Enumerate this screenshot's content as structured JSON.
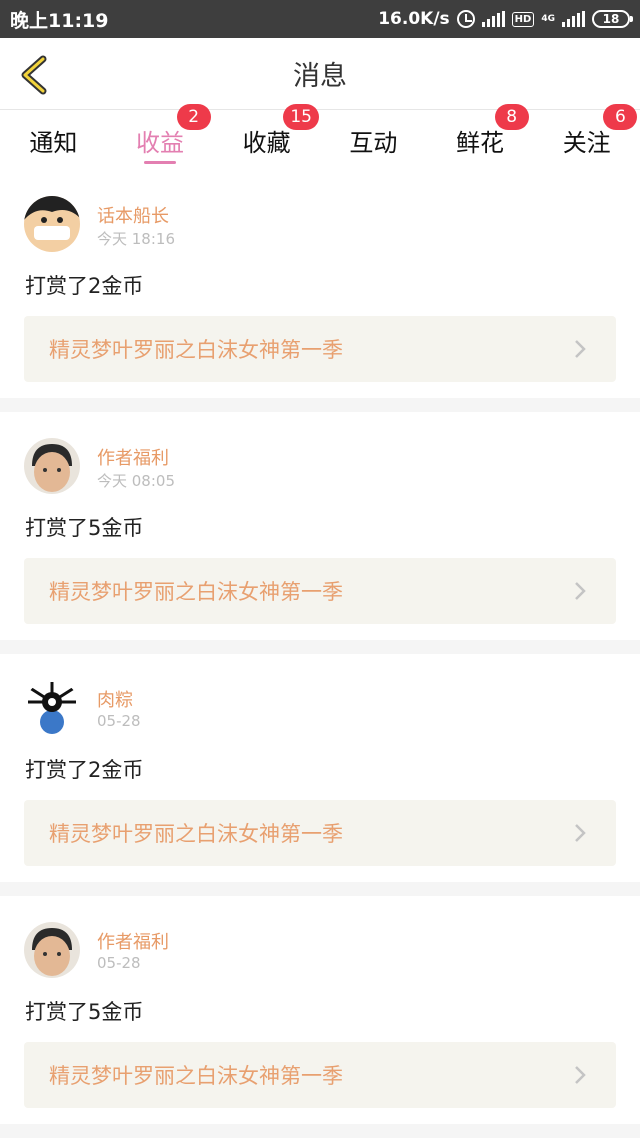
{
  "status_bar": {
    "time": "晚上11:19",
    "speed": "16.0K/s",
    "hd": "HD",
    "net": "4G",
    "battery": "18"
  },
  "header": {
    "title": "消息"
  },
  "tabs": [
    {
      "label": "通知",
      "badge": ""
    },
    {
      "label": "收益",
      "badge": "2",
      "active": true
    },
    {
      "label": "收藏",
      "badge": "15"
    },
    {
      "label": "互动",
      "badge": ""
    },
    {
      "label": "鲜花",
      "badge": "8"
    },
    {
      "label": "关注",
      "badge": "6"
    }
  ],
  "messages": [
    {
      "user": "话本船长",
      "time": "今天 18:16",
      "action": "打赏了2金币",
      "book": "精灵梦叶罗丽之白沫女神第一季"
    },
    {
      "user": "作者福利",
      "time": "今天 08:05",
      "action": "打赏了5金币",
      "book": "精灵梦叶罗丽之白沫女神第一季"
    },
    {
      "user": "肉粽",
      "time": "05-28",
      "action": "打赏了2金币",
      "book": "精灵梦叶罗丽之白沫女神第一季"
    },
    {
      "user": "作者福利",
      "time": "05-28",
      "action": "打赏了5金币",
      "book": "精灵梦叶罗丽之白沫女神第一季"
    }
  ],
  "colors": {
    "accent": "#e37fb1",
    "badge": "#ee3a4a",
    "name": "#e79a66",
    "book": "#e8a070"
  }
}
